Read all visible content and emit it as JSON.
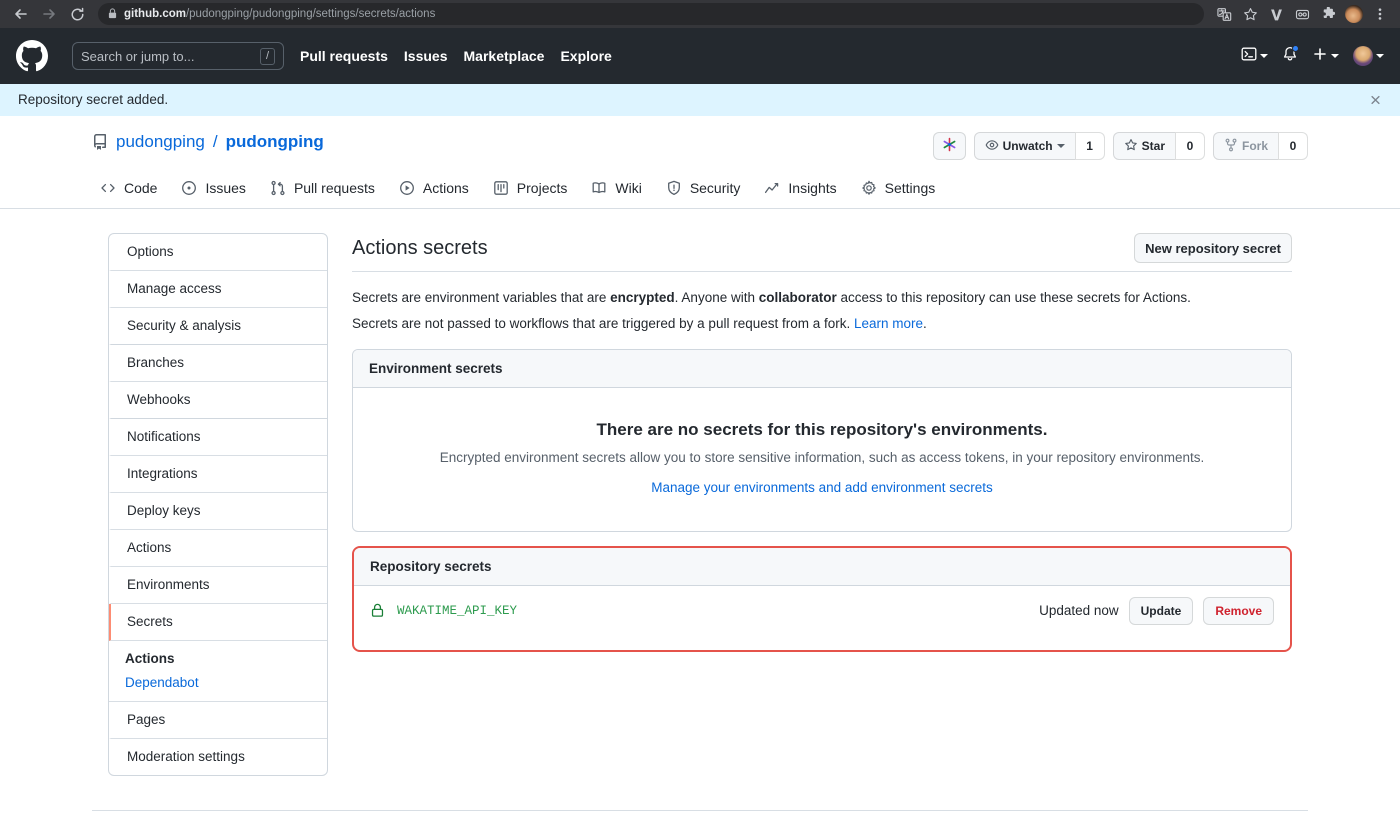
{
  "browser": {
    "back_label": "Back",
    "forward_label": "Forward",
    "reload_label": "Reload",
    "url_domain": "github.com",
    "url_path": "/pudongping/pudongping/settings/secrets/actions",
    "toolbar_icons": [
      "translate-icon",
      "bookmark-star-icon",
      "vimium-icon",
      "loom-icon",
      "extensions-puzzle-icon",
      "profile-avatar",
      "chrome-menu-icon"
    ]
  },
  "gh_header": {
    "logo": "github-mark-icon",
    "search_placeholder": "Search or jump to...",
    "search_key_hint": "/",
    "nav": [
      {
        "label": "Pull requests"
      },
      {
        "label": "Issues"
      },
      {
        "label": "Marketplace"
      },
      {
        "label": "Explore"
      }
    ],
    "codespaces_icon": "terminal-icon",
    "notifications_icon": "bell-icon",
    "create_new_icon": "plus-icon",
    "avatar_icon": "user-avatar"
  },
  "flash": {
    "message": "Repository secret added.",
    "close_icon": "close-x-icon",
    "background": "#ddf4ff"
  },
  "repo": {
    "icon": "repo-icon",
    "owner": "pudongping",
    "separator": "/",
    "name": "pudongping",
    "sparkle_icon": "sparkle-icon",
    "watch": {
      "icon": "eye-icon",
      "label": "Unwatch",
      "count": "1"
    },
    "star": {
      "icon": "star-icon",
      "label": "Star",
      "count": "0"
    },
    "fork": {
      "icon": "fork-icon",
      "label": "Fork",
      "count": "0"
    },
    "tabs": [
      {
        "label": "Code",
        "icon": "code-icon"
      },
      {
        "label": "Issues",
        "icon": "issue-opened-icon"
      },
      {
        "label": "Pull requests",
        "icon": "git-pull-request-icon"
      },
      {
        "label": "Actions",
        "icon": "play-icon"
      },
      {
        "label": "Projects",
        "icon": "project-icon"
      },
      {
        "label": "Wiki",
        "icon": "book-icon"
      },
      {
        "label": "Security",
        "icon": "shield-icon"
      },
      {
        "label": "Insights",
        "icon": "graph-icon"
      },
      {
        "label": "Settings",
        "icon": "gear-icon"
      }
    ]
  },
  "sidebar": {
    "items": [
      {
        "label": "Options",
        "selected": false
      },
      {
        "label": "Manage access",
        "selected": false
      },
      {
        "label": "Security & analysis",
        "selected": false
      },
      {
        "label": "Branches",
        "selected": false
      },
      {
        "label": "Webhooks",
        "selected": false
      },
      {
        "label": "Notifications",
        "selected": false
      },
      {
        "label": "Integrations",
        "selected": false
      },
      {
        "label": "Deploy keys",
        "selected": false
      },
      {
        "label": "Actions",
        "selected": false
      },
      {
        "label": "Environments",
        "selected": false
      },
      {
        "label": "Secrets",
        "selected": true
      }
    ],
    "sub_items": [
      {
        "label": "Actions",
        "active": true
      },
      {
        "label": "Dependabot",
        "active": false
      }
    ],
    "tail_items": [
      {
        "label": "Pages"
      },
      {
        "label": "Moderation settings"
      }
    ],
    "selected_accent": "#fd8c73"
  },
  "main": {
    "title": "Actions secrets",
    "new_secret_button": "New repository secret",
    "desc_line1_a": "Secrets are environment variables that are ",
    "desc_line1_b": "encrypted",
    "desc_line1_c": ". Anyone with ",
    "desc_line1_d": "collaborator",
    "desc_line1_e": " access to this repository can use these secrets for Actions.",
    "desc_line2_a": "Secrets are not passed to workflows that are triggered by a pull request from a fork. ",
    "desc_line2_link": "Learn more",
    "desc_line2_end": ".",
    "environment_box": {
      "header": "Environment secrets",
      "blank_title": "There are no secrets for this repository's environments.",
      "blank_sub": "Encrypted environment secrets allow you to store sensitive information, such as access tokens, in your repository environments.",
      "blank_link": "Manage your environments and add environment secrets"
    },
    "repository_box": {
      "header": "Repository secrets",
      "highlight_color": "#e5534b",
      "secrets": [
        {
          "lock_icon": "lock-icon",
          "name": "WAKATIME_API_KEY",
          "name_color": "#2d9b4e",
          "updated": "Updated now",
          "update_button": "Update",
          "remove_button": "Remove"
        }
      ]
    }
  }
}
